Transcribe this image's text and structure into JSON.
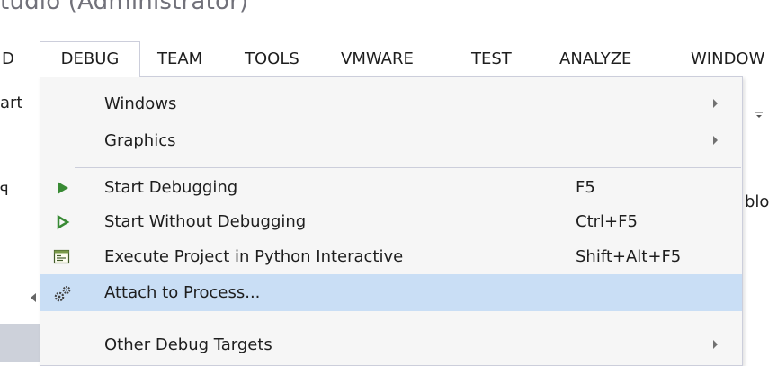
{
  "window": {
    "title_fragment": "tudio (Administrator)"
  },
  "menubar": {
    "items": [
      {
        "label": "D"
      },
      {
        "label": "DEBUG"
      },
      {
        "label": "TEAM"
      },
      {
        "label": "TOOLS"
      },
      {
        "label": "VMWARE"
      },
      {
        "label": "TEST"
      },
      {
        "label": "ANALYZE"
      },
      {
        "label": "WINDOW"
      }
    ]
  },
  "background": {
    "left_fragment": "art",
    "right_fragment": "blo",
    "pin_glyph": "ꟼ",
    "pin_icon": "pin-icon",
    "toolbar_dropdown_icon": "overflow-dropdown-icon"
  },
  "debug_menu": {
    "items": [
      {
        "label": "Windows",
        "shortcut": "",
        "submenu": true,
        "icon": ""
      },
      {
        "label": "Graphics",
        "shortcut": "",
        "submenu": true,
        "icon": ""
      },
      {
        "label": "Start Debugging",
        "shortcut": "F5",
        "submenu": false,
        "icon": "play-solid-icon"
      },
      {
        "label": "Start Without Debugging",
        "shortcut": "Ctrl+F5",
        "submenu": false,
        "icon": "play-outline-icon"
      },
      {
        "label": "Execute Project in Python Interactive",
        "shortcut": "Shift+Alt+F5",
        "submenu": false,
        "icon": "python-interactive-icon"
      },
      {
        "label": "Attach to Process...",
        "shortcut": "",
        "submenu": false,
        "icon": "gears-icon",
        "highlighted": true
      },
      {
        "label": "Other Debug Targets",
        "shortcut": "",
        "submenu": true,
        "icon": ""
      }
    ]
  },
  "colors": {
    "highlight": "#c9def5",
    "menu_bg": "#f6f6f6",
    "play_green": "#388a34",
    "border": "#cccedb"
  }
}
